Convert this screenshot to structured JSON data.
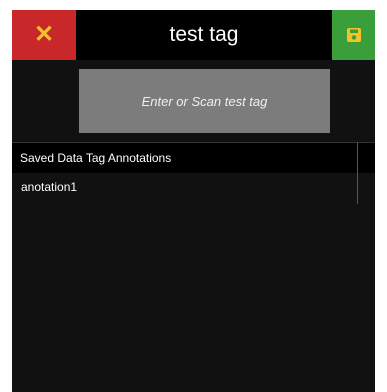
{
  "header": {
    "title": "test tag",
    "cancel_icon": "close-icon",
    "save_icon": "save-icon"
  },
  "scan": {
    "label": "Enter or Scan test tag"
  },
  "annotations": {
    "header": "Saved Data Tag Annotations",
    "items": [
      "anotation1"
    ]
  },
  "colors": {
    "cancel_bg": "#c8282a",
    "cancel_icon": "#f5c22b",
    "save_bg": "#3a9f3a",
    "save_icon": "#f5c22b",
    "scan_bg": "#7c7c7c"
  }
}
